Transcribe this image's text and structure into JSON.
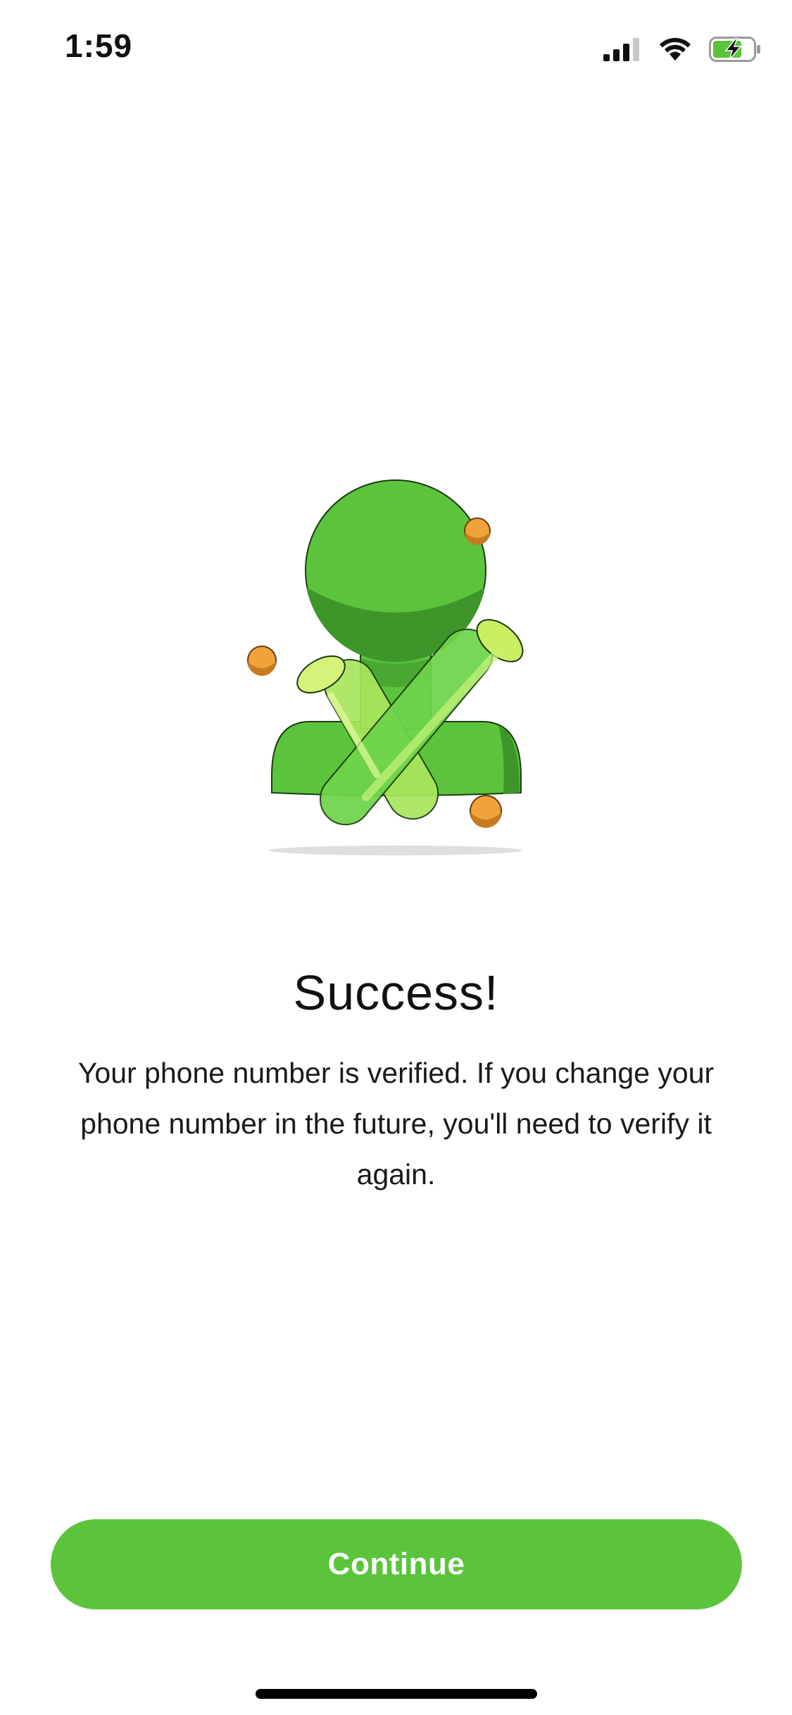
{
  "status_bar": {
    "time": "1:59",
    "icons": [
      "cellular-signal-icon",
      "wifi-icon",
      "battery-charging-icon"
    ]
  },
  "illustration": {
    "icon": "verified-checkmark-illustration",
    "colors": {
      "primary_green": "#5bc43c",
      "dark_green": "#3e962b",
      "light_green": "#a9e65c",
      "orange": "#f0a33a"
    }
  },
  "content": {
    "title": "Success!",
    "message": "Your phone number is verified. If you change your phone number in the future, you'll need to verify it again."
  },
  "actions": {
    "continue_label": "Continue"
  },
  "colors": {
    "accent": "#5bc43c",
    "background": "#ffffff",
    "text": "#111111"
  }
}
